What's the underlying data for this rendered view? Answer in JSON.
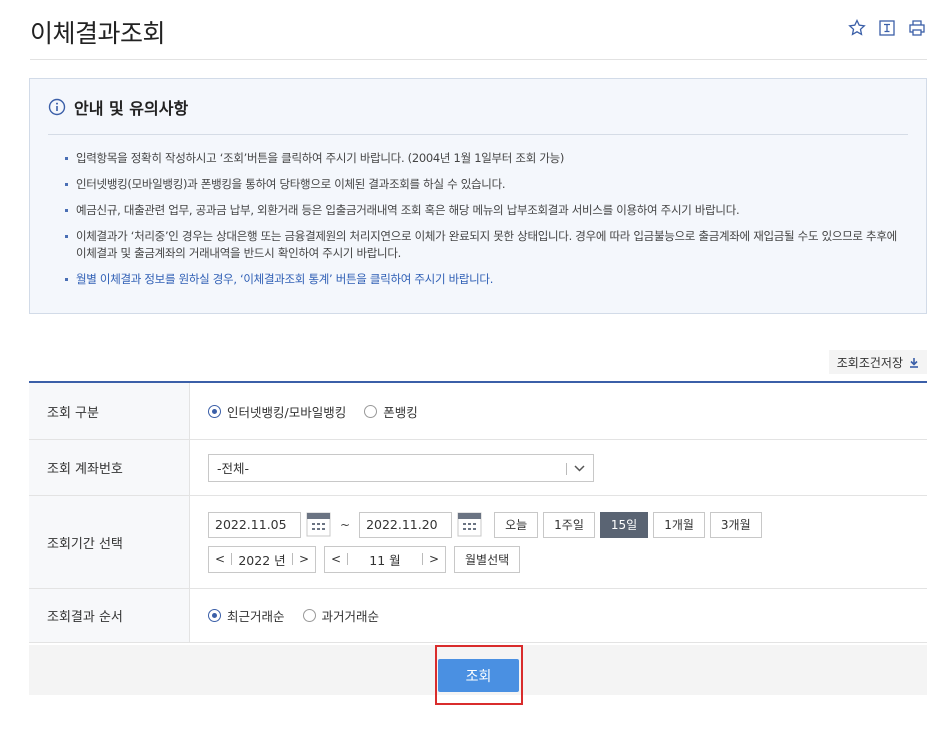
{
  "page": {
    "title": "이체결과조회"
  },
  "notice": {
    "title": "안내 및 유의사항",
    "items": [
      "입력항목을 정확히 작성하시고 ‘조회’버튼을 클릭하여 주시기 바랍니다. (2004년 1월 1일부터 조회 가능)",
      "인터넷뱅킹(모바일뱅킹)과 폰뱅킹을 통하여 당타행으로 이체된 결과조회를 하실 수 있습니다.",
      "예금신규, 대출관련 업무, 공과금 납부, 외환거래 등은 입출금거래내역 조회 혹은 해당 메뉴의 납부조회결과 서비스를 이용하여 주시기 바랍니다.",
      "이체결과가 ‘처리중’인 경우는 상대은행 또는 금융결제원의 처리지연으로 이체가 완료되지 못한 상태입니다. 경우에 따라 입금불능으로 출금계좌에 재입금될 수도 있으므로 추후에 이체결과 및 출금계좌의 거래내역을 반드시 확인하여 주시기 바랍니다.",
      "월별 이체결과 정보를 원하실 경우, ‘이체결과조회 통계’ 버튼을 클릭하여 주시기 바랍니다."
    ]
  },
  "save_condition": "조회조건저장",
  "form": {
    "inquiry_type": {
      "label": "조회 구분",
      "options": [
        "인터넷뱅킹/모바일뱅킹",
        "폰뱅킹"
      ],
      "selected": 0
    },
    "account": {
      "label": "조회 계좌번호",
      "selected_value": "-전체-"
    },
    "period": {
      "label": "조회기간 선택",
      "start_date": "2022.11.05",
      "end_date": "2022.11.20",
      "tilde": "~",
      "quick": [
        "오늘",
        "1주일",
        "15일",
        "1개월",
        "3개월"
      ],
      "quick_selected": 2,
      "year": "2022 년",
      "month": "11 월",
      "month_select": "월별선택"
    },
    "order": {
      "label": "조회결과 순서",
      "options": [
        "최근거래순",
        "과거거래순"
      ],
      "selected": 0
    }
  },
  "submit_label": "조회",
  "colors": {
    "accent": "#3b5fa8",
    "button": "#4a90e2",
    "highlight": "#d92c2c",
    "selected_chip": "#5a6473"
  }
}
